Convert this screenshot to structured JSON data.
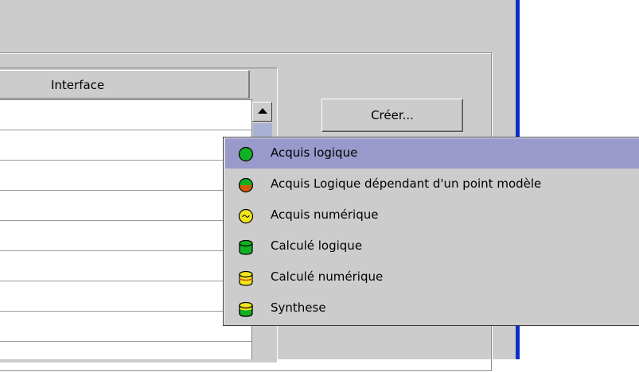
{
  "table": {
    "column_header": "Interface"
  },
  "create_button": {
    "label": "Créer..."
  },
  "menu": {
    "items": [
      {
        "label": "Acquis logique",
        "icon": "green-circle-icon",
        "selected": true
      },
      {
        "label": "Acquis Logique dépendant d'un point modèle",
        "icon": "green-orange-circle-icon",
        "selected": false
      },
      {
        "label": "Acquis numérique",
        "icon": "yellow-circle-icon",
        "selected": false
      },
      {
        "label": "Calculé logique",
        "icon": "green-cylinder-icon",
        "selected": false
      },
      {
        "label": "Calculé numérique",
        "icon": "yellow-cylinder-icon",
        "selected": false
      },
      {
        "label": "Synthese",
        "icon": "yellow-green-cylinder-icon",
        "selected": false
      }
    ]
  },
  "colors": {
    "dialog_bg": "#cccccc",
    "selection": "#9999cc",
    "window_edge": "#0a2ecb",
    "green": "#12b024",
    "orange": "#d35a0c",
    "yellow": "#f2e61a"
  }
}
